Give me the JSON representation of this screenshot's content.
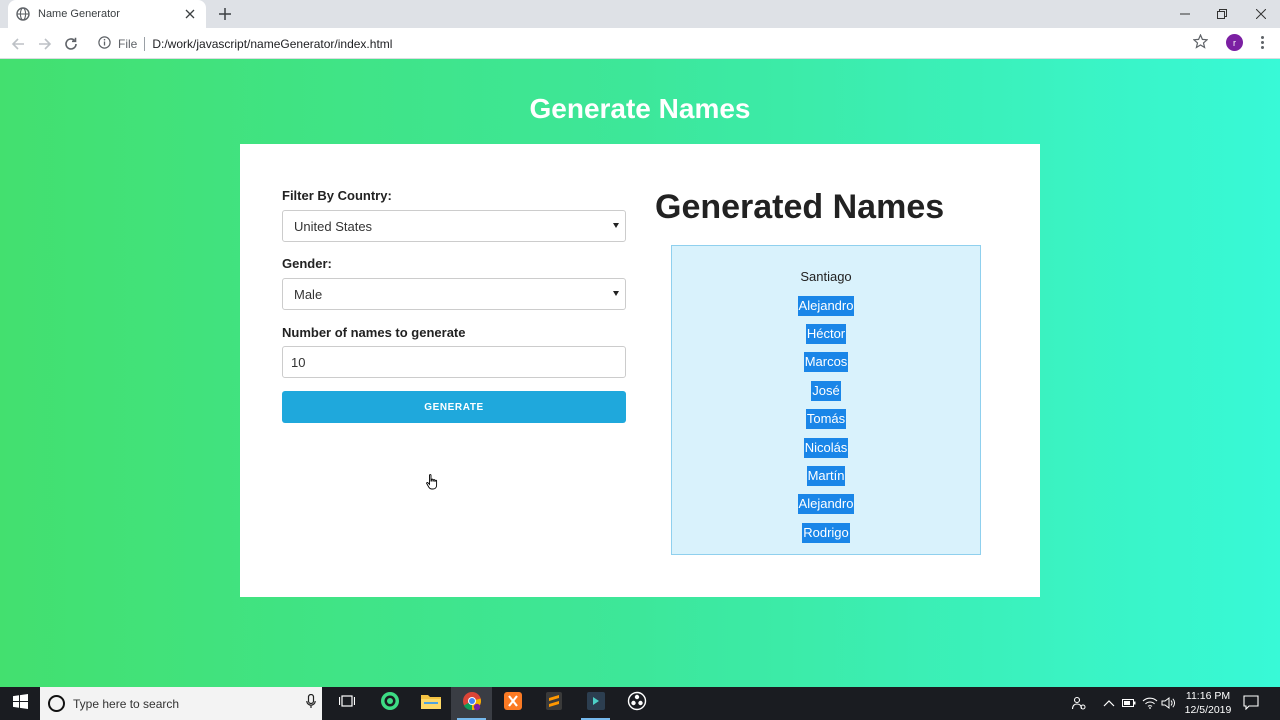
{
  "browser": {
    "tab_title": "Name Generator",
    "file_label": "File",
    "url": "D:/work/javascript/nameGenerator/index.html",
    "profile_initial": "r"
  },
  "page": {
    "heading": "Generate Names",
    "form": {
      "country_label": "Filter By Country:",
      "country_value": "United States",
      "gender_label": "Gender:",
      "gender_value": "Male",
      "count_label": "Number of names to generate",
      "count_value": "10",
      "generate_label": "GENERATE"
    },
    "results": {
      "heading": "Generated Names",
      "names": [
        "Santiago",
        "Alejandro",
        "Héctor",
        "Marcos",
        "José",
        "Tomás",
        "Nicolás",
        "Martín",
        "Alejandro",
        "Rodrigo"
      ],
      "selection_color": "#1a86e8"
    }
  },
  "taskbar": {
    "search_placeholder": "Type here to search",
    "time": "11:16 PM",
    "date": "12/5/2019"
  },
  "colors": {
    "gradient_start": "#43e06f",
    "gradient_end": "#38f9d7",
    "button": "#1fa8dc",
    "results_bg": "#d9f2fc"
  }
}
